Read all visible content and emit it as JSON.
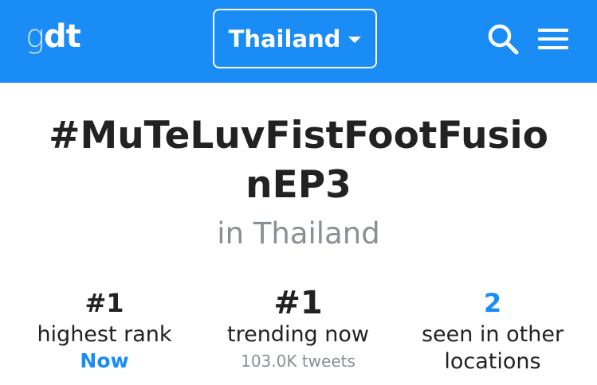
{
  "header": {
    "logo_prefix": "g",
    "logo_main": "dt",
    "country": "Thailand",
    "search_icon": "search-icon",
    "menu_icon": "hamburger-menu-icon",
    "accent_color": "#1a8cf5"
  },
  "trend": {
    "hashtag": "#MuTeLuvFistFootFusionEP3",
    "location_label": "in Thailand"
  },
  "stats": [
    {
      "value": "#1",
      "label": "highest rank",
      "sub": "Now"
    },
    {
      "value": "#1",
      "label": "trending now",
      "sub": "103.0K tweets"
    },
    {
      "value": "2",
      "label": "seen in other locations",
      "sub": ""
    }
  ]
}
